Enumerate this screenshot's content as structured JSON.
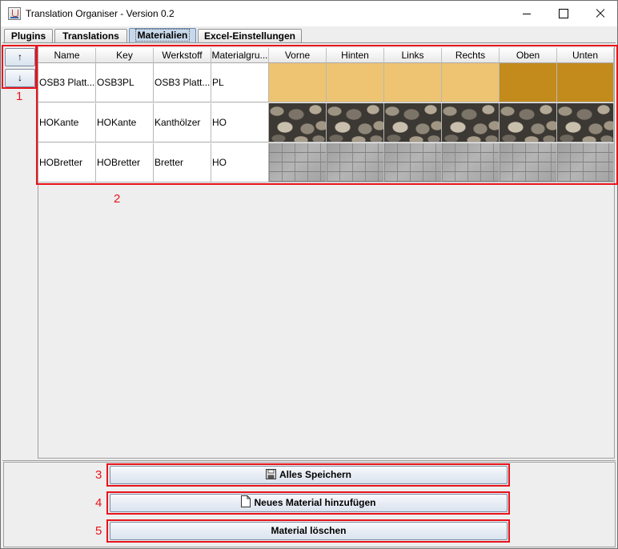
{
  "window": {
    "title": "Translation Organiser - Version 0.2"
  },
  "tabs": [
    {
      "label": "Plugins",
      "active": false
    },
    {
      "label": "Translations",
      "active": false
    },
    {
      "label": "Materialien",
      "active": true
    },
    {
      "label": "Excel-Einstellungen",
      "active": false
    }
  ],
  "move_buttons": {
    "up_label": "↑",
    "down_label": "↓"
  },
  "table": {
    "columns": [
      "Name",
      "Key",
      "Werkstoff",
      "Materialgru...",
      "Vorne",
      "Hinten",
      "Links",
      "Rechts",
      "Oben",
      "Unten"
    ],
    "rows": [
      {
        "name": "OSB3 Platt...",
        "key": "OSB3PL",
        "werkstoff": "OSB3 Platt...",
        "materialgruppe": "PL",
        "texture": "osb-wood",
        "colors": [
          "#eec472",
          "#eec472",
          "#eec472",
          "#eec472",
          "#c28b1c",
          "#c28b1c"
        ]
      },
      {
        "name": "HOKante",
        "key": "HOKante",
        "werkstoff": "Kanthölzer",
        "materialgruppe": "HO",
        "texture": "stone-wall"
      },
      {
        "name": "HOBretter",
        "key": "HOBretter",
        "werkstoff": "Bretter",
        "materialgruppe": "HO",
        "texture": "grey-paving"
      }
    ]
  },
  "actions": {
    "save_label": "Alles Speichern",
    "save_icon": "floppy-disk-icon",
    "add_label": "Neues Material hinzufügen",
    "add_icon": "document-icon",
    "delete_label": "Material löschen"
  },
  "annotations": [
    "1",
    "2",
    "3",
    "4",
    "5"
  ],
  "colors": {
    "annotation": "#e8131b",
    "active_tab": "#c7d8ea"
  }
}
